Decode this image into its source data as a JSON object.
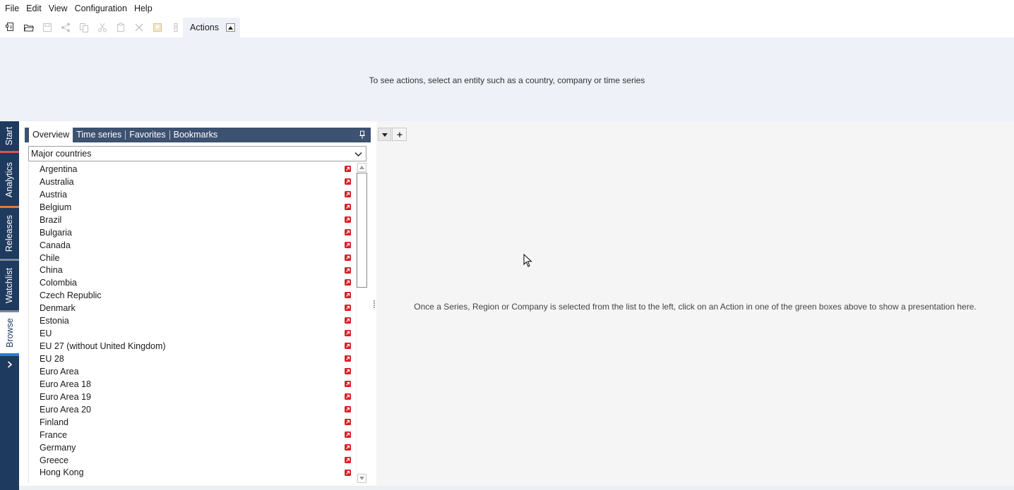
{
  "menu": {
    "items": [
      "File",
      "Edit",
      "View",
      "Configuration",
      "Help"
    ]
  },
  "toolbar": {
    "icons": [
      "new-document-icon",
      "open-folder-icon",
      "save-icon",
      "share-icon",
      "copy-icon",
      "cut-icon",
      "paste-icon",
      "delete-icon",
      "image-icon",
      "more-icon"
    ],
    "actions_label": "Actions"
  },
  "actions_panel": {
    "hint": "To see actions, select an entity such as a country, company or time series"
  },
  "side_tabs": {
    "items": [
      {
        "label": "Start",
        "accent": "#d9534f"
      },
      {
        "label": "Analytics",
        "accent": "#e07b39"
      },
      {
        "label": "Releases",
        "accent": "#7a8b99"
      },
      {
        "label": "Watchlist",
        "accent": "#7a8b99"
      },
      {
        "label": "Browse",
        "accent": "#2a7bd8"
      }
    ],
    "active": "Browse"
  },
  "browse": {
    "tabs": [
      "Overview",
      "Time series",
      "Favorites",
      "Bookmarks"
    ],
    "active_tab": "Overview",
    "region_select": "Major countries",
    "countries": [
      "Argentina",
      "Australia",
      "Austria",
      "Belgium",
      "Brazil",
      "Bulgaria",
      "Canada",
      "Chile",
      "China",
      "Colombia",
      "Czech Republic",
      "Denmark",
      "Estonia",
      "EU",
      "EU 27 (without United Kingdom)",
      "EU 28",
      "Euro Area",
      "Euro Area 18",
      "Euro Area 19",
      "Euro Area 20",
      "Finland",
      "France",
      "Germany",
      "Greece",
      "Hong Kong"
    ]
  },
  "presentation": {
    "hint": "Once a Series, Region or Company is selected from the list to the left, click on an Action in one of the green boxes above to show a presentation here."
  },
  "colors": {
    "nav_dark": "#1f3a5f",
    "header_blue": "#3d5170",
    "link_red": "#d81f26",
    "actions_bg": "#eef1f8"
  }
}
